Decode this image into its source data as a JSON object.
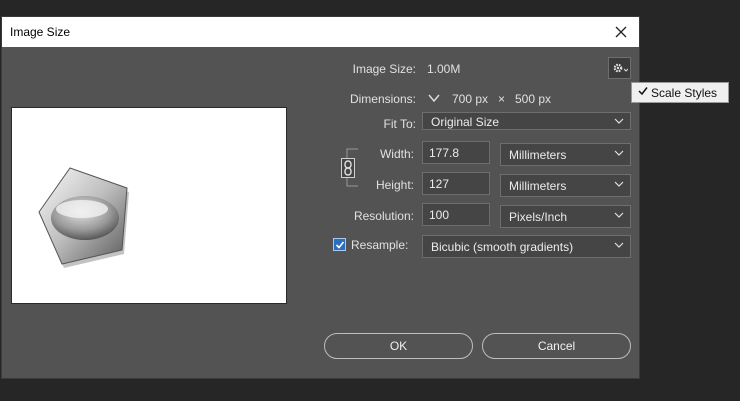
{
  "dialog": {
    "title": "Image Size",
    "image_size_label": "Image Size:",
    "image_size_value": "1.00M",
    "dimensions_label": "Dimensions:",
    "dimensions_width": "700 px",
    "dimensions_times": "×",
    "dimensions_height": "500 px",
    "fit_to_label": "Fit To:",
    "fit_to_value": "Original Size",
    "width_label": "Width:",
    "width_value": "177.8",
    "width_unit": "Millimeters",
    "height_label": "Height:",
    "height_value": "127",
    "height_unit": "Millimeters",
    "resolution_label": "Resolution:",
    "resolution_value": "100",
    "resolution_unit": "Pixels/Inch",
    "resample_label": "Resample:",
    "resample_checked": true,
    "resample_value": "Bicubic (smooth gradients)",
    "ok_label": "OK",
    "cancel_label": "Cancel"
  },
  "settings_menu": {
    "icon": "gear-icon",
    "items": [
      {
        "label": "Scale Styles",
        "checked": true
      }
    ]
  },
  "icons": {
    "close": "close-icon",
    "link": "chain-link-icon",
    "chevron": "chevron-down-icon",
    "check": "checkmark-icon"
  },
  "colors": {
    "dialog_bg": "#535353",
    "field_bg": "#454545",
    "checkbox": "#2d6dbf"
  }
}
